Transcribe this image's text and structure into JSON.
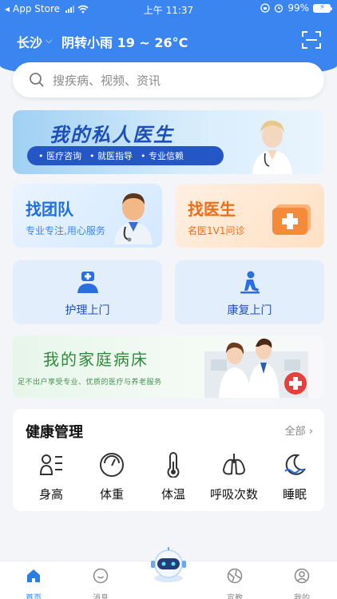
{
  "status_bar": {
    "carrier": "App Store",
    "time": "上午 11:37",
    "battery": "99%"
  },
  "header": {
    "city": "长沙",
    "weather": "阴转小雨 19 ~ 26°C"
  },
  "search": {
    "placeholder": "搜疾病、视频、资讯"
  },
  "banner": {
    "title": "我的私人医生",
    "tags": [
      "医疗咨询",
      "就医指导",
      "专业信赖"
    ]
  },
  "cards": {
    "team": {
      "title": "找团队",
      "subtitle": "专业专注,用心服务"
    },
    "doctor": {
      "title": "找医生",
      "subtitle": "名医1V1问诊"
    }
  },
  "services": {
    "nursing": "护理上门",
    "rehab": "康复上门"
  },
  "family_banner": {
    "title": "我的家庭病床",
    "subtitle": "足不出户享受专业、优质的医疗与养老服务"
  },
  "health": {
    "title": "健康管理",
    "all_label": "全部",
    "items": [
      "身高",
      "体重",
      "体温",
      "呼吸次数",
      "睡眠"
    ]
  },
  "tabbar": {
    "items": [
      "首页",
      "消息",
      "宣教",
      "我的"
    ],
    "active": "首页"
  },
  "colors": {
    "primary": "#3a85f0",
    "accent_orange": "#ef6d17",
    "family_green": "#2f8a3d"
  }
}
